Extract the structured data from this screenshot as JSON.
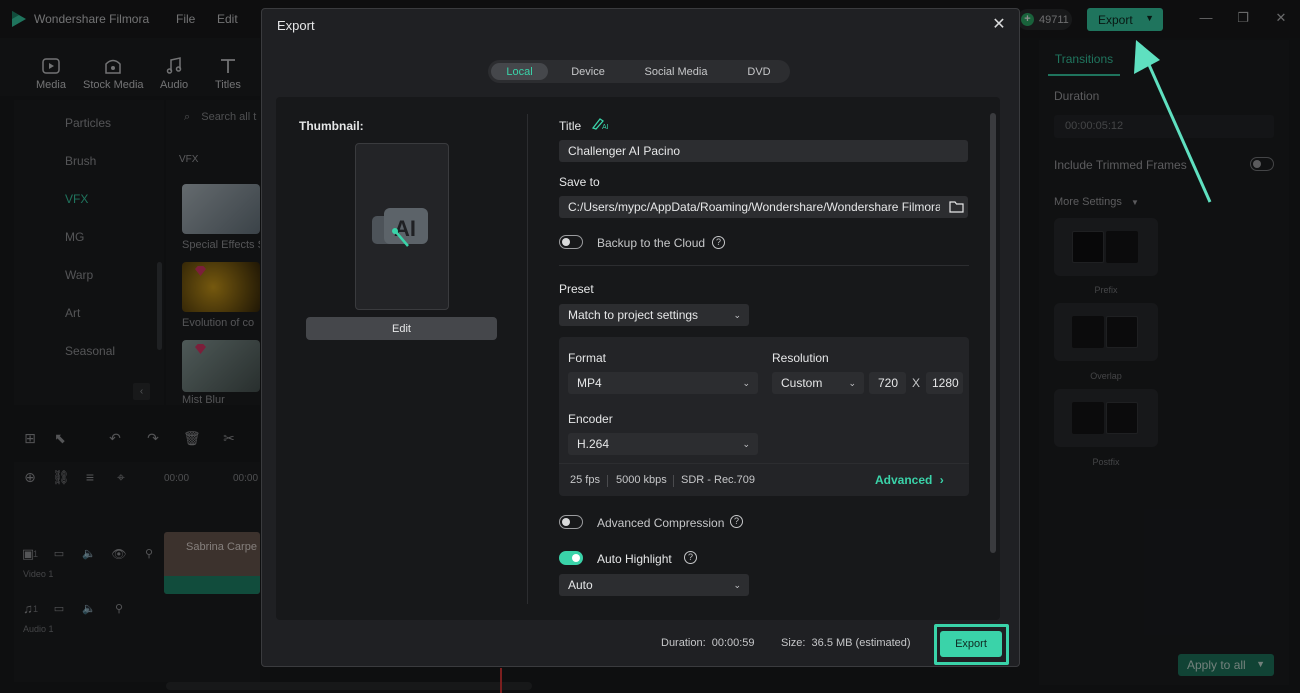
{
  "app": {
    "title": "Wondershare Filmora",
    "menu": [
      "File",
      "Edit"
    ],
    "credits": "49711",
    "export_label": "Export"
  },
  "toolbar": {
    "items": [
      "Media",
      "Stock Media",
      "Audio",
      "Titles"
    ]
  },
  "categories": [
    "Particles",
    "Brush",
    "VFX",
    "MG",
    "Warp",
    "Art",
    "Seasonal"
  ],
  "media": {
    "search_placeholder": "Search all t",
    "section": "VFX",
    "items": [
      "Special Effects S",
      "Evolution of co",
      "Mist Blur"
    ]
  },
  "timeline": {
    "ruler": [
      "00:00",
      "00:00"
    ],
    "video_track": "Video 1",
    "audio_track": "Audio 1",
    "video_track_num": "1",
    "audio_track_num": "1",
    "clip_name": "Sabrina Carpe"
  },
  "right_panel": {
    "tab": "Transitions",
    "duration_label": "Duration",
    "duration_value": "00:00:05:12",
    "include_trimmed": "Include Trimmed Frames",
    "more_settings": "More Settings",
    "presets": [
      "Prefix",
      "Overlap",
      "Postfix"
    ],
    "apply_all": "Apply to all"
  },
  "dialog": {
    "title": "Export",
    "tabs": [
      "Local",
      "Device",
      "Social Media",
      "DVD"
    ],
    "active_tab": "Local",
    "thumbnail_label": "Thumbnail:",
    "edit_label": "Edit",
    "title_label": "Title",
    "title_value": "Challenger AI Pacino",
    "save_to_label": "Save to",
    "save_to_value": "C:/Users/mypc/AppData/Roaming/Wondershare/Wondershare Filmora",
    "backup_label": "Backup to the Cloud",
    "preset_label": "Preset",
    "preset_value": "Match to project settings",
    "format_label": "Format",
    "format_value": "MP4",
    "resolution_label": "Resolution",
    "resolution_value": "Custom",
    "width": "720",
    "x_sep": "X",
    "height": "1280",
    "encoder_label": "Encoder",
    "encoder_value": "H.264",
    "fps": "25 fps",
    "bitrate": "5000 kbps",
    "color": "SDR - Rec.709",
    "advanced_label": "Advanced",
    "advanced_compression": "Advanced Compression",
    "auto_highlight": "Auto Highlight",
    "auto_value": "Auto",
    "duration_label": "Duration:",
    "duration_value": "00:00:59",
    "size_label": "Size:",
    "size_value": "36.5 MB (estimated)",
    "export_label": "Export",
    "backup_on": false,
    "advanced_compression_on": false,
    "auto_highlight_on": true
  },
  "colors": {
    "accent": "#3ad3a9",
    "dialog_bg": "#1f2023",
    "body_bg": "#17181a"
  }
}
